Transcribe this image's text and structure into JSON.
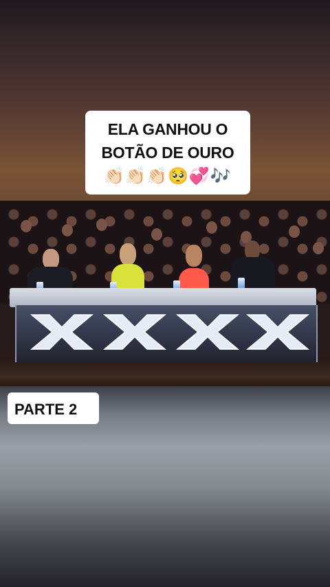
{
  "caption": {
    "line1": "ELA GANHOU O",
    "line2": "BOTÃO DE OURO",
    "emojis": "👏🏻👏🏻👏🏻🥺💞🎶"
  },
  "part_label": "PARTE 2",
  "video": {
    "description_icons": [
      "x-buzzer-icon",
      "x-buzzer-icon",
      "x-buzzer-icon",
      "x-buzzer-icon"
    ]
  },
  "colors": {
    "caption_bg": "#ffffff",
    "caption_text": "#111111",
    "desk_x": "#e6ecf5"
  }
}
